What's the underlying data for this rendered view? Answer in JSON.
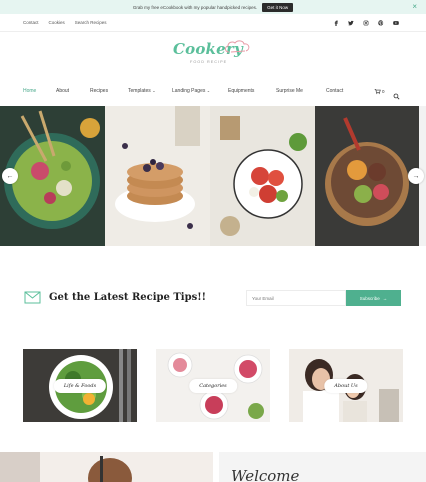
{
  "notice": {
    "text": "Grab my free eCookbook with my popular handpicked recipes.",
    "button_label": "Get it Now",
    "close_label": "×"
  },
  "topbar": {
    "links": [
      "Contact",
      "Cookies",
      "Search Recipes"
    ],
    "socials": [
      "facebook-icon",
      "twitter-icon",
      "instagram-icon",
      "pinterest-icon",
      "youtube-icon"
    ]
  },
  "brand": {
    "name": "Cookery",
    "tagline": "FOOD RECIPE",
    "accent_color": "#5bbf9b"
  },
  "nav": {
    "items": [
      {
        "label": "Home",
        "active": true
      },
      {
        "label": "About"
      },
      {
        "label": "Recipes"
      },
      {
        "label": "Templates",
        "dropdown": true
      },
      {
        "label": "Landing Pages",
        "dropdown": true
      },
      {
        "label": "Equipments"
      },
      {
        "label": "Surprise Me"
      },
      {
        "label": "Contact"
      }
    ],
    "cart_count": "0"
  },
  "slider": {
    "prev_label": "←",
    "next_label": "→"
  },
  "newsletter": {
    "title": "Get the Latest Recipe Tips!!",
    "email_placeholder": "Your Email",
    "button_label": "Subscribe",
    "button_color": "#4fb08f"
  },
  "categories": [
    {
      "label": "Life & Foods"
    },
    {
      "label": "Categories"
    },
    {
      "label": "About Us"
    }
  ],
  "bottom": {
    "welcome": "Welcome"
  }
}
